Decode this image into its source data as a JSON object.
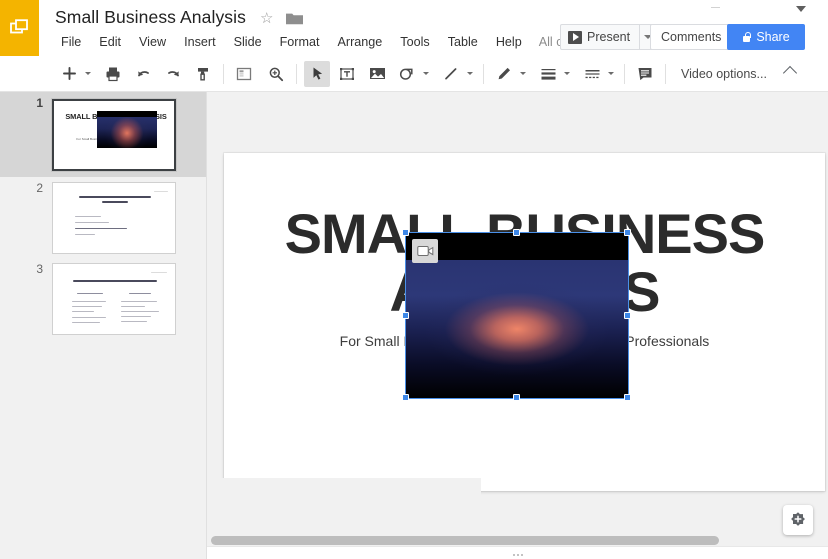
{
  "app": {
    "name": "Google Slides",
    "logo_icon": "slides-logo-icon",
    "brand_color": "#F4B400",
    "accent_color": "#4285F4"
  },
  "header": {
    "doc_title": "Small Business Analysis",
    "star_icon": "star-icon",
    "star_glyph": "☆",
    "folder_icon": "folder-icon",
    "menus": [
      {
        "label": "File"
      },
      {
        "label": "Edit"
      },
      {
        "label": "View"
      },
      {
        "label": "Insert"
      },
      {
        "label": "Slide"
      },
      {
        "label": "Format"
      },
      {
        "label": "Arrange"
      },
      {
        "label": "Tools"
      },
      {
        "label": "Table"
      },
      {
        "label": "Help"
      }
    ],
    "menu_overflow": "All c...",
    "present_label": "Present",
    "present_icon": "play-icon",
    "present_dropdown_icon": "chevron-down-icon",
    "comments_label": "Comments",
    "share_label": "Share",
    "share_icon": "lock-icon",
    "window_collapse_icon": "chevron-down-icon"
  },
  "toolbar": {
    "items": [
      {
        "name": "new-slide-button",
        "icon": "plus-icon",
        "has_caret": true,
        "active": false
      },
      {
        "name": "print-button",
        "icon": "printer-icon",
        "has_caret": false,
        "active": false
      },
      {
        "name": "undo-button",
        "icon": "undo-icon",
        "has_caret": false,
        "active": false
      },
      {
        "name": "redo-button",
        "icon": "redo-icon",
        "has_caret": false,
        "active": false
      },
      {
        "name": "paint-format-button",
        "icon": "paint-format-icon",
        "has_caret": false,
        "active": false
      },
      {
        "name": "layout-button",
        "icon": "layout-icon",
        "has_caret": false,
        "active": false
      },
      {
        "name": "zoom-button",
        "icon": "magnifier-icon",
        "has_caret": false,
        "active": false
      },
      {
        "name": "select-tool-button",
        "icon": "cursor-arrow-icon",
        "has_caret": false,
        "active": true
      },
      {
        "name": "text-box-button",
        "icon": "text-box-icon",
        "has_caret": false,
        "active": false
      },
      {
        "name": "insert-image-button",
        "icon": "image-icon",
        "has_caret": false,
        "active": false
      },
      {
        "name": "shape-button",
        "icon": "shape-icon",
        "has_caret": true,
        "active": false
      },
      {
        "name": "line-button",
        "icon": "line-icon",
        "has_caret": true,
        "active": false
      },
      {
        "name": "pen-color-button",
        "icon": "pencil-icon",
        "has_caret": true,
        "active": false
      },
      {
        "name": "line-weight-button",
        "icon": "line-weight-icon",
        "has_caret": true,
        "active": false
      },
      {
        "name": "line-dash-button",
        "icon": "line-dash-icon",
        "has_caret": true,
        "active": false
      },
      {
        "name": "speaker-notes-button",
        "icon": "notes-icon",
        "has_caret": false,
        "active": false
      }
    ],
    "video_options_label": "Video options...",
    "collapse_toolbar_icon": "chevron-up-icon"
  },
  "filmstrip": {
    "slides": [
      {
        "number": "1",
        "selected": true,
        "title": "SMALL BUSINESS ANALYSIS",
        "subtitle": "For Small Business Owners and Independent Professionals",
        "has_video": true
      },
      {
        "number": "2",
        "selected": false,
        "title": "WHAT SMALL BUSINESSES NEED TO KNOW",
        "subtitle": "",
        "has_video": false
      },
      {
        "number": "3",
        "selected": false,
        "title": "SELF EMPLOYMENT VS EMPLOYEE (S.E.)",
        "subtitle": "",
        "has_video": false
      }
    ]
  },
  "slide": {
    "title": "SMALL BUSINESS ANALYSIS",
    "subtitle": "For Small Business Owners and Independent Professionals",
    "video": {
      "name": "video-placeholder",
      "badge_icon": "video-camera-icon",
      "selected": true,
      "handles": 8
    }
  },
  "footer": {
    "explore_button_icon": "explore-icon",
    "horizontal_scrollbar": "h-scrollbar",
    "resize_grip_icon": "grip-dots-icon"
  }
}
